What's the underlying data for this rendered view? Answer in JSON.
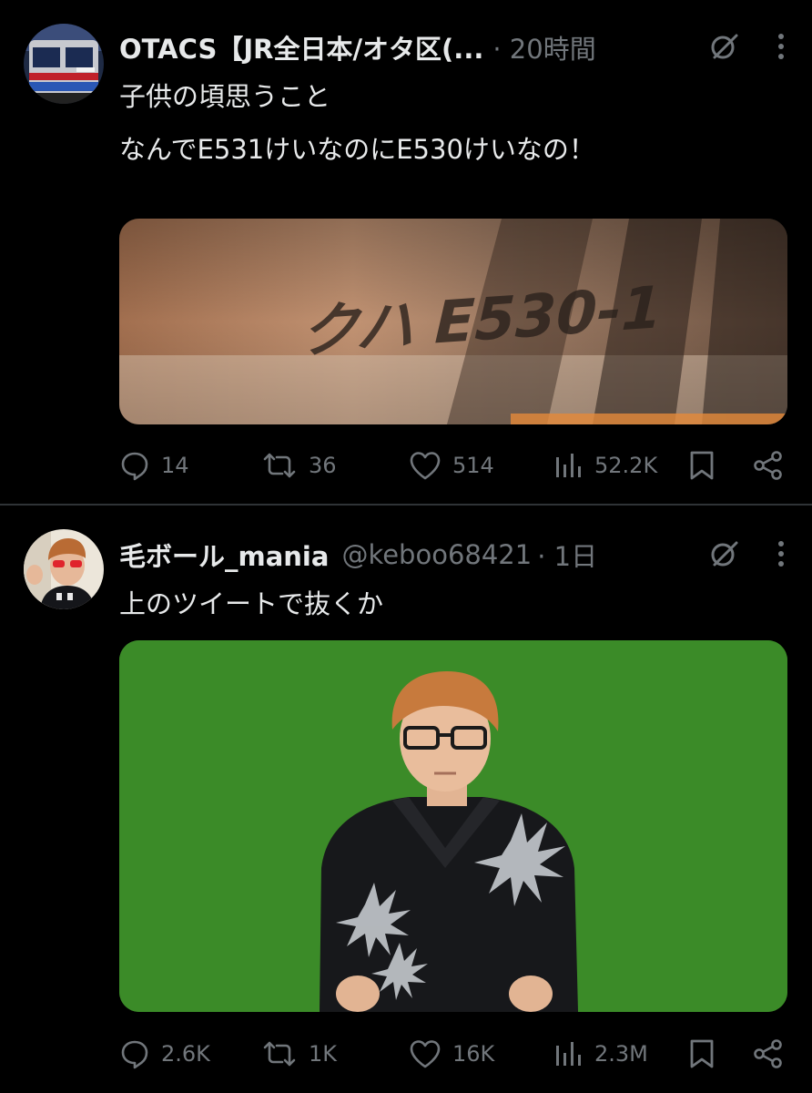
{
  "tweets": [
    {
      "display_name": "OTACS【JR全日本/オタ区(...",
      "time": "· 20時間",
      "text": "子供の頃思うこと\n\nなんでE531けいなのにE530けいなの！",
      "media_caption": "クハ E530-1",
      "stats": {
        "replies": "14",
        "retweets": "36",
        "likes": "514",
        "views": "52.2K"
      }
    },
    {
      "display_name": "毛ボール_mania",
      "handle": "@keboo68421",
      "time": "· 1日",
      "text": "上のツイートで抜くか",
      "stats": {
        "replies": "2.6K",
        "retweets": "1K",
        "likes": "16K",
        "views": "2.3M"
      }
    }
  ],
  "icons": [
    "grok-icon",
    "more-icon",
    "reply-icon",
    "retweet-icon",
    "like-icon",
    "views-icon",
    "bookmark-icon",
    "share-icon"
  ],
  "colors": {
    "background": "#000000",
    "text": "#e7e9ea",
    "muted": "#71767b",
    "divider": "#2f3336",
    "greenscreen": "#3a8a27"
  }
}
